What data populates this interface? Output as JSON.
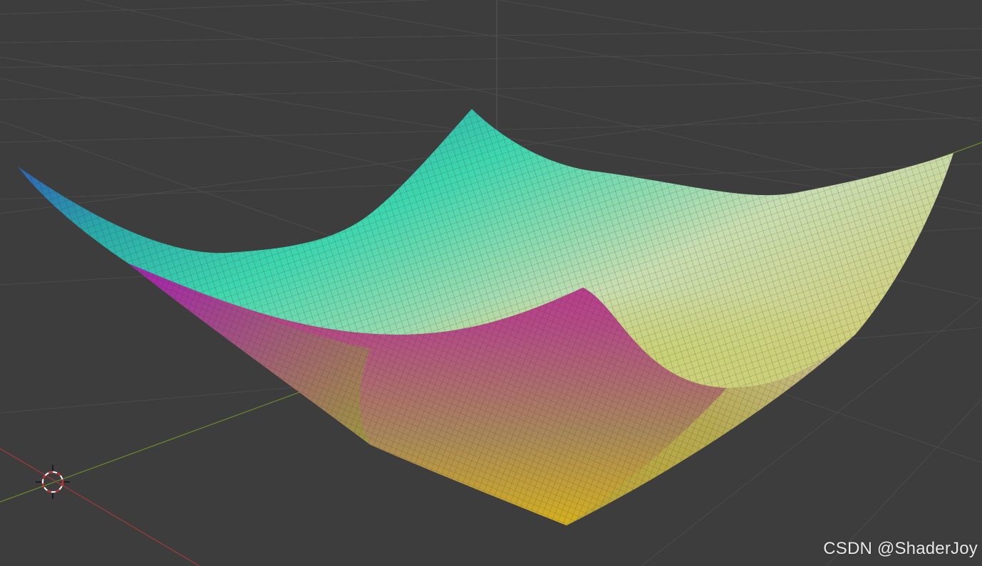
{
  "watermark": {
    "text": "CSDN @ShaderJoy"
  },
  "viewport": {
    "background": "#3d3d3d",
    "grid_color": "#4a4a4a",
    "axis_x_color": "#a23a3a",
    "axis_y_color": "#6a8a2a",
    "axis_z_color": "#5a5a5a"
  },
  "surface": {
    "shape": "bowl-saddle-mesh",
    "corner_colors": {
      "top_left": "#3a3fc4",
      "top_back": "#3ed6ae",
      "top_right": "#d8ddb0",
      "front_corner": "#c0189a",
      "bottom": "#d8b820"
    },
    "wireframe_color": "#2a2a2a"
  },
  "cursor_3d": {
    "icon": "3d-cursor-icon"
  }
}
